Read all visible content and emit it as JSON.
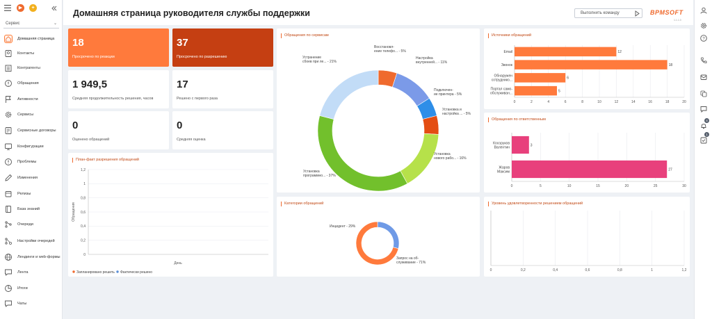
{
  "app": {
    "section": "Сервис",
    "accent": "#ef6a2e"
  },
  "sidebar": {
    "items": [
      {
        "label": "Домашняя страница",
        "icon": "home-icon",
        "active": true
      },
      {
        "label": "Контакты",
        "icon": "contact-icon"
      },
      {
        "label": "Контрагенты",
        "icon": "accounts-icon"
      },
      {
        "label": "Обращения",
        "icon": "cases-icon"
      },
      {
        "label": "Активности",
        "icon": "flag-icon"
      },
      {
        "label": "Сервисы",
        "icon": "gear-icon"
      },
      {
        "label": "Сервисные договоры",
        "icon": "contract-icon"
      },
      {
        "label": "Конфигурации",
        "icon": "config-icon"
      },
      {
        "label": "Проблемы",
        "icon": "problem-icon"
      },
      {
        "label": "Изменения",
        "icon": "pencil-icon"
      },
      {
        "label": "Релизы",
        "icon": "release-icon"
      },
      {
        "label": "База знаний",
        "icon": "book-icon"
      },
      {
        "label": "Очереди",
        "icon": "queue-icon"
      },
      {
        "label": "Настройки очередей",
        "icon": "queue-settings-icon"
      },
      {
        "label": "Лендинги и web-формы",
        "icon": "globe-icon"
      },
      {
        "label": "Лента",
        "icon": "feed-icon"
      },
      {
        "label": "Итоги",
        "icon": "pie-icon"
      },
      {
        "label": "Чаты",
        "icon": "chat-icon"
      }
    ]
  },
  "header": {
    "title": "Домашняя страница руководителя службы поддержки",
    "command_placeholder": "Выполнить команду",
    "logo": "BPMSOFT",
    "version": "1.1.1.0"
  },
  "kpis": [
    {
      "value": "18",
      "caption": "Просрочено по реакции"
    },
    {
      "value": "37",
      "caption": "Просрочено по разрешению"
    },
    {
      "value": "1 949,5",
      "caption": "Средняя продолжительность решения, часов"
    },
    {
      "value": "17",
      "caption": "Решено с первого раза"
    },
    {
      "value": "0",
      "caption": "Оценено обращений"
    },
    {
      "value": "0",
      "caption": "Средняя оценка"
    }
  ],
  "rightbar": {
    "badges": [
      "4",
      "1"
    ]
  },
  "chart_data": [
    {
      "type": "line",
      "title": "План-факт разрешения обращений",
      "xlabel": "День",
      "ylabel": "Обращения",
      "yticks": [
        "0",
        "0,2",
        "0,4",
        "0,6",
        "0,8",
        "1",
        "1,2"
      ],
      "ylim": [
        0,
        1.2
      ],
      "series": [
        {
          "name": "Запланировано решить",
          "color": "#ef6a2e",
          "values": []
        },
        {
          "name": "Фактически решено",
          "color": "#5b8fd6",
          "values": []
        }
      ],
      "legend": "bottom-left"
    },
    {
      "type": "pie",
      "title": "Обращения по сервисам",
      "slices": [
        {
          "label": "Восстановл-\nение телефо... - 5%",
          "value": 5,
          "color": "#ef6a2e"
        },
        {
          "label": "Настройка\nвнутренней... - 11%",
          "value": 11,
          "color": "#7b9ae8"
        },
        {
          "label": "Подключен-\nие принтера - 5%",
          "value": 5,
          "color": "#2e8ee8"
        },
        {
          "label": "Установка и\nнастройка ... - 5%",
          "value": 5,
          "color": "#e44d12"
        },
        {
          "label": "Установка\nнового рабо... - 16%",
          "value": 16,
          "color": "#b6e14a"
        },
        {
          "label": "Установка\nпрограммно... - 37%",
          "value": 37,
          "color": "#72c02c"
        },
        {
          "label": "Устранение\nсбоев при ле... - 21%",
          "value": 21,
          "color": "#c2dcf7"
        }
      ]
    },
    {
      "type": "pie",
      "title": "Категории обращений",
      "slices": [
        {
          "label": "Инцидент - 29%",
          "value": 29,
          "color": "#6f9ae6"
        },
        {
          "label": "Запрос на об-\nслуживание - 71%",
          "value": 71,
          "color": "#ff7a3c"
        }
      ]
    },
    {
      "type": "bar",
      "orientation": "horizontal",
      "title": "Источники обращений",
      "categories": [
        "Email",
        "Звонок",
        "Обнаружен\nсотруднико...",
        "Портал само-\nобслуживан..."
      ],
      "values": [
        12,
        18,
        6,
        5
      ],
      "color": "#ff7a3c",
      "xticks": [
        "0",
        "2",
        "4",
        "6",
        "8",
        "10",
        "12",
        "14",
        "16",
        "18",
        "20"
      ],
      "xlim": [
        0,
        20
      ]
    },
    {
      "type": "bar",
      "orientation": "horizontal",
      "title": "Обращения по ответственным",
      "categories": [
        "Косоруков\nВалентин",
        "Жаров\nМаксим"
      ],
      "values": [
        3,
        27
      ],
      "color": "#e8407c",
      "xticks": [
        "0",
        "5",
        "10",
        "15",
        "20",
        "25",
        "30"
      ],
      "xlim": [
        0,
        30
      ]
    },
    {
      "type": "bar",
      "orientation": "horizontal",
      "title": "Уровень удовлетворенности решением обращений",
      "categories": [],
      "values": [],
      "xticks": [
        "0",
        "0,2",
        "0,4",
        "0,6",
        "0,8",
        "1",
        "1,2"
      ],
      "xlim": [
        0,
        1.2
      ]
    }
  ]
}
